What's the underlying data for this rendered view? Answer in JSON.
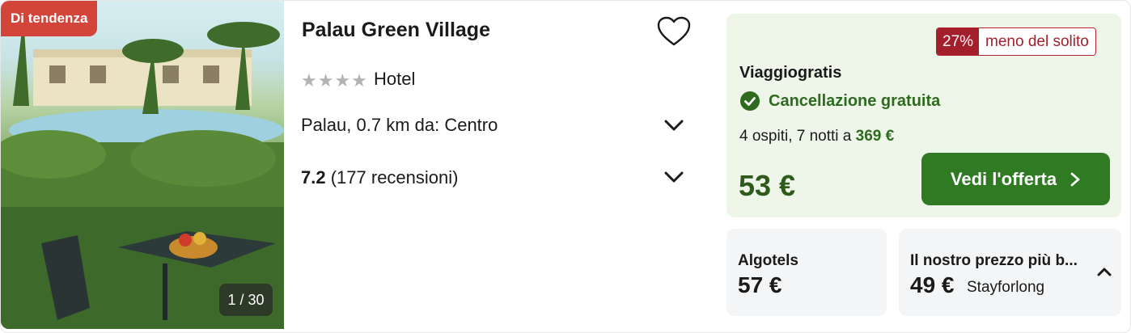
{
  "photo": {
    "badge": "Di tendenza",
    "counter": "1 / 30"
  },
  "hotel": {
    "name": "Palau Green Village",
    "stars": "★★★★",
    "star_count": 4,
    "type": "Hotel",
    "location": "Palau, 0.7 km da: Centro",
    "rating_score": "7.2",
    "rating_reviews": "(177 recensioni)"
  },
  "offer": {
    "discount_pct": "27%",
    "discount_text": "meno del solito",
    "provider": "Viaggiogratis",
    "free_cancellation": "Cancellazione gratuita",
    "stay_prefix": "4 ospiti, 7 notti a",
    "stay_total": "369 €",
    "price": "53 €",
    "cta": "Vedi l'offerta"
  },
  "alternatives": [
    {
      "name": "Algotels",
      "price": "57 €"
    },
    {
      "name": "Il nostro prezzo più b...",
      "price": "49 €",
      "seller": "Stayforlong"
    }
  ],
  "colors": {
    "badge_red": "#d3453a",
    "discount_red": "#a31f2c",
    "offer_bg": "#eef6e9",
    "cta_green": "#2f7a22",
    "price_green": "#2e5a1c"
  },
  "icons": [
    "heart-icon",
    "chevron-down-icon",
    "check-circle-icon",
    "chevron-right-icon",
    "chevron-up-icon"
  ]
}
